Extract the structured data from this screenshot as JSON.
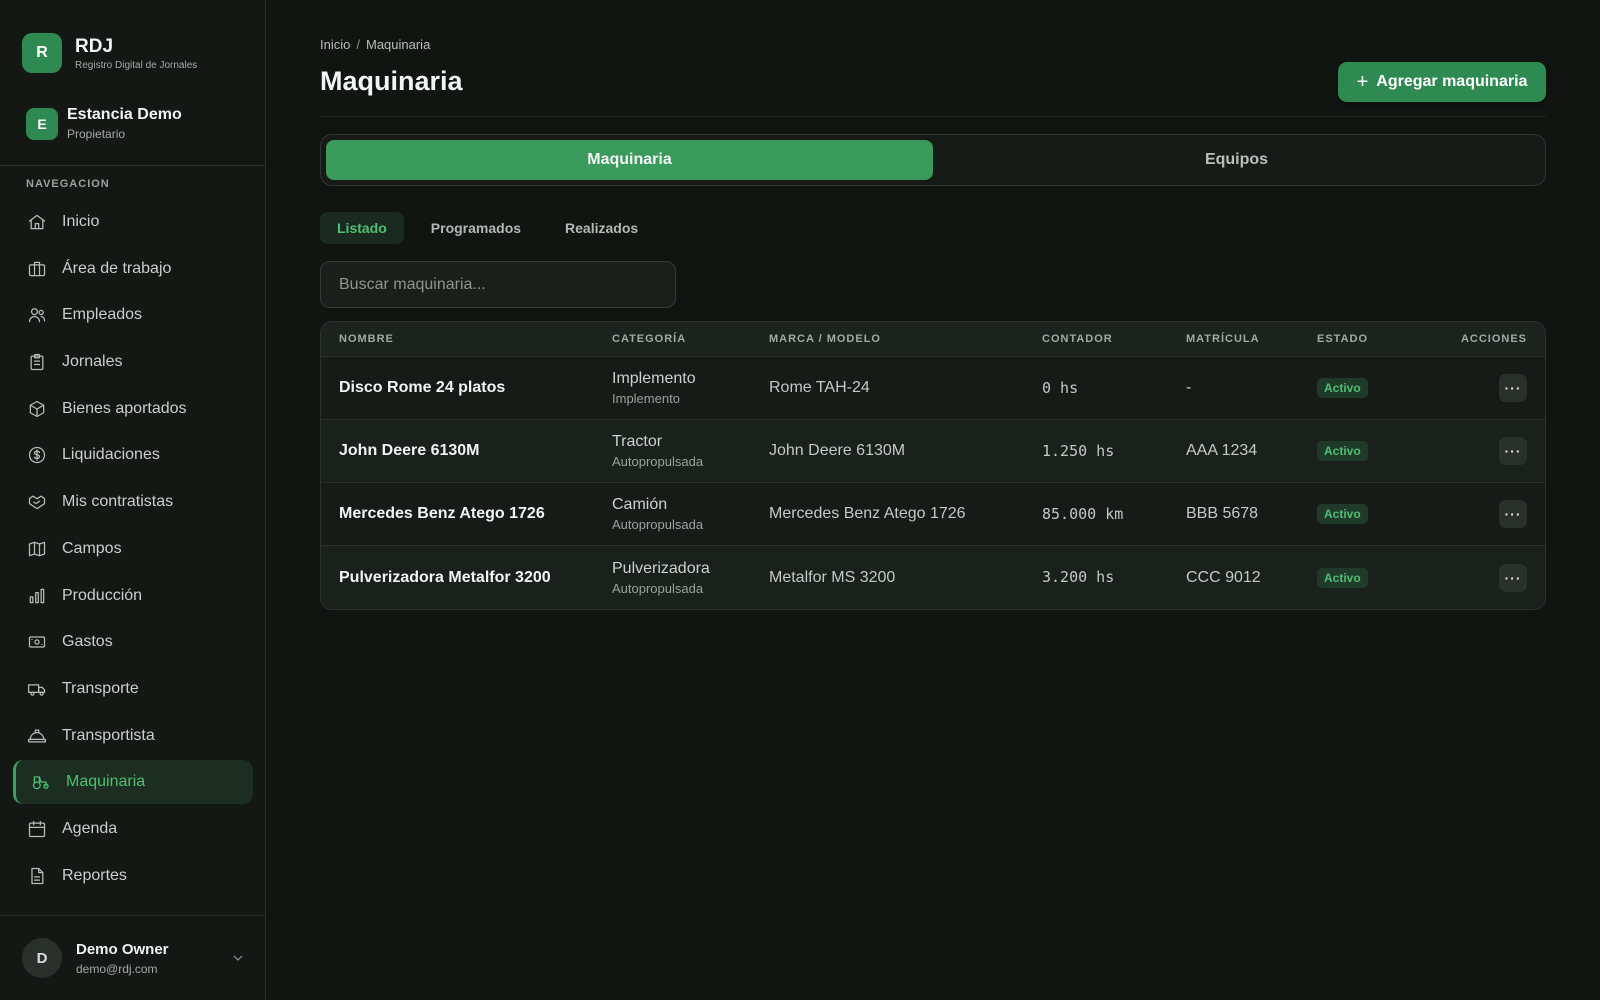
{
  "brand": {
    "logo_letter": "R",
    "title": "RDJ",
    "subtitle": "Registro Digital de Jornales"
  },
  "org": {
    "logo_letter": "E",
    "name": "Estancia Demo",
    "role": "Propietario"
  },
  "nav": {
    "section_title": "NAVEGACION",
    "items": [
      {
        "label": "Inicio",
        "icon": "home-icon"
      },
      {
        "label": "Área de trabajo",
        "icon": "briefcase-icon"
      },
      {
        "label": "Empleados",
        "icon": "users-icon"
      },
      {
        "label": "Jornales",
        "icon": "clipboard-icon"
      },
      {
        "label": "Bienes aportados",
        "icon": "package-icon"
      },
      {
        "label": "Liquidaciones",
        "icon": "dollar-circle-icon"
      },
      {
        "label": "Mis contratistas",
        "icon": "handshake-icon"
      },
      {
        "label": "Campos",
        "icon": "map-icon"
      },
      {
        "label": "Producción",
        "icon": "bar-chart-icon"
      },
      {
        "label": "Gastos",
        "icon": "banknote-icon"
      },
      {
        "label": "Transporte",
        "icon": "truck-icon"
      },
      {
        "label": "Transportista",
        "icon": "hard-hat-icon"
      },
      {
        "label": "Maquinaria",
        "icon": "tractor-icon",
        "active": true
      },
      {
        "label": "Agenda",
        "icon": "calendar-icon"
      },
      {
        "label": "Reportes",
        "icon": "file-text-icon"
      }
    ]
  },
  "user": {
    "avatar_letter": "D",
    "name": "Demo Owner",
    "email": "demo@rdj.com"
  },
  "breadcrumb": {
    "home": "Inicio",
    "sep": "/",
    "current": "Maquinaria"
  },
  "page": {
    "title": "Maquinaria",
    "add_button": "Agregar maquinaria"
  },
  "segments": {
    "machinery": "Maquinaria",
    "equipment": "Equipos"
  },
  "subtabs": {
    "list": "Listado",
    "scheduled": "Programados",
    "done": "Realizados"
  },
  "search": {
    "placeholder": "Buscar maquinaria..."
  },
  "table": {
    "headers": {
      "name": "NOMBRE",
      "category": "CATEGORÍA",
      "brand_model": "MARCA / MODELO",
      "counter": "CONTADOR",
      "plate": "MATRÍCULA",
      "status": "ESTADO",
      "actions": "ACCIONES"
    },
    "rows": [
      {
        "name": "Disco Rome 24 platos",
        "category": "Implemento",
        "category_sub": "Implemento",
        "brand_model": "Rome TAH-24",
        "counter": "0 hs",
        "plate": "-",
        "status": "Activo",
        "actions": "···"
      },
      {
        "name": "John Deere 6130M",
        "category": "Tractor",
        "category_sub": "Autopropulsada",
        "brand_model": "John Deere 6130M",
        "counter": "1.250 hs",
        "plate": "AAA 1234",
        "status": "Activo",
        "actions": "···"
      },
      {
        "name": "Mercedes Benz Atego 1726",
        "category": "Camión",
        "category_sub": "Autopropulsada",
        "brand_model": "Mercedes Benz Atego 1726",
        "counter": "85.000 km",
        "plate": "BBB 5678",
        "status": "Activo",
        "actions": "···"
      },
      {
        "name": "Pulverizadora Metalfor 3200",
        "category": "Pulverizadora",
        "category_sub": "Autopropulsada",
        "brand_model": "Metalfor MS 3200",
        "counter": "3.200 hs",
        "plate": "CCC 9012",
        "status": "Activo",
        "actions": "···"
      }
    ]
  },
  "colors": {
    "accent": "#2f8a52",
    "accent_text": "#4fbf74",
    "background": "#101512"
  }
}
